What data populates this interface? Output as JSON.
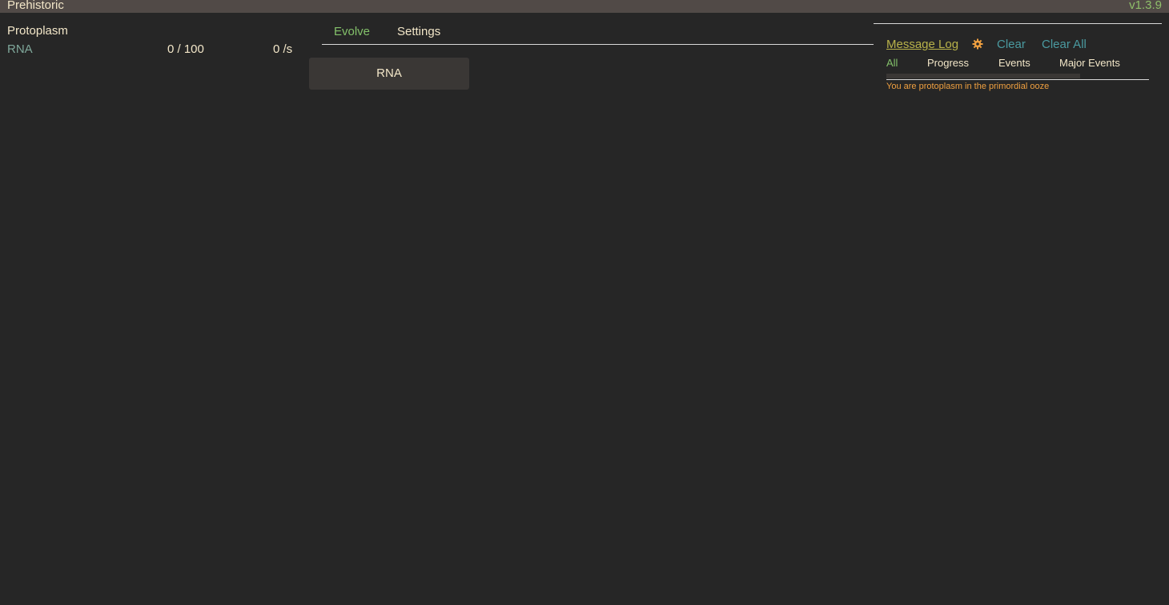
{
  "topbar": {
    "title": "Prehistoric",
    "version": "v1.3.9"
  },
  "resources": {
    "header": "Protoplasm",
    "rows": [
      {
        "name": "RNA",
        "amount": "0 / 100",
        "rate": "0 /s"
      }
    ]
  },
  "tabs": [
    {
      "label": "Evolve",
      "active": true
    },
    {
      "label": "Settings",
      "active": false
    }
  ],
  "evolve": {
    "buttons": [
      {
        "label": "RNA"
      }
    ]
  },
  "message_log": {
    "title": "Message Log",
    "gear_icon": "gear-icon",
    "clear_label": "Clear",
    "clear_all_label": "Clear All",
    "filters": [
      {
        "label": "All",
        "active": true
      },
      {
        "label": "Progress",
        "active": false
      },
      {
        "label": "Events",
        "active": false
      },
      {
        "label": "Major Events",
        "active": false
      }
    ],
    "entries": [
      {
        "text": "You are protoplasm in the primordial ooze"
      }
    ]
  },
  "colors": {
    "background": "#262626",
    "topbar": "#514a47",
    "text": "#f2e6c8",
    "active_green": "#83c06a",
    "resource_name": "#7fa79a",
    "link_teal": "#4a9aa0",
    "log_title": "#b8b24a",
    "warning_orange": "#f0a040",
    "button_bg": "#3a3735"
  }
}
